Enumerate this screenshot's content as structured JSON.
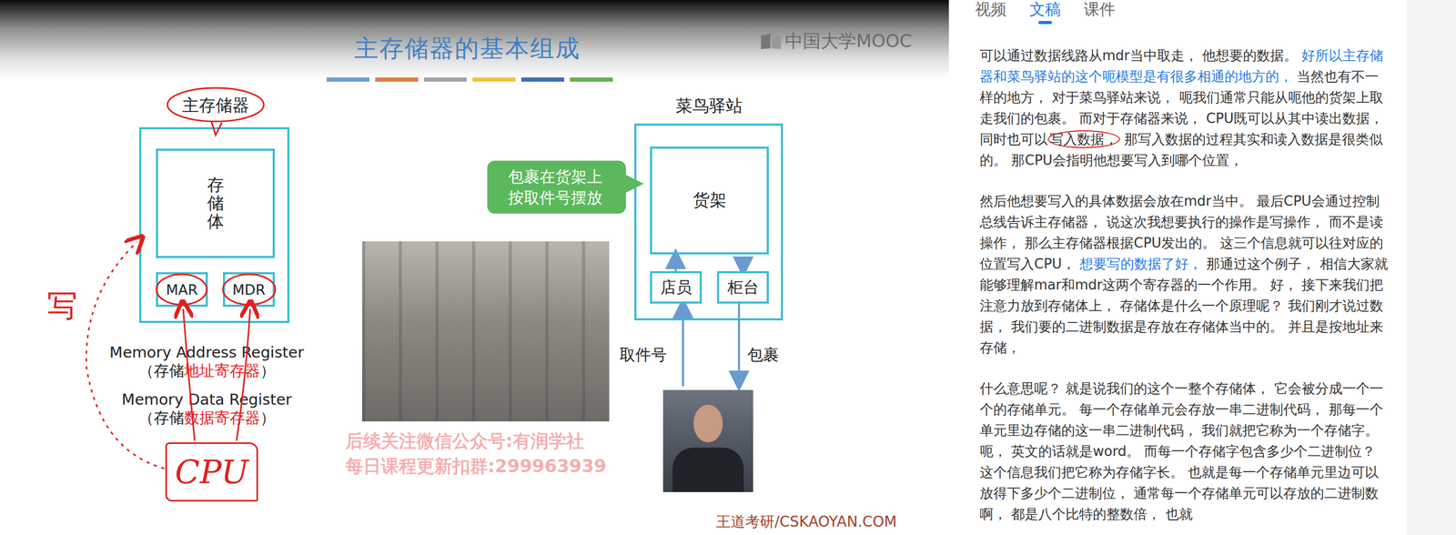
{
  "video": {
    "slide": {
      "title": "主存储器的基本组成",
      "logo": "中国大学MOOC",
      "memory": {
        "title": "主存储器",
        "storage": "存储体",
        "registers": [
          {
            "label": "MAR"
          },
          {
            "label": "MDR"
          }
        ],
        "legend": [
          {
            "english": "Memory Address Register",
            "chinese": [
              {
                "text": "（存储",
                "red": false
              },
              {
                "text": "地址寄存器",
                "red": true
              },
              {
                "text": "）",
                "red": false
              }
            ]
          },
          {
            "english": "Memory Data Register",
            "chinese": [
              {
                "text": "（存储",
                "red": false
              },
              {
                "text": "数据寄存器",
                "red": true
              },
              {
                "text": "）",
                "red": false
              }
            ]
          }
        ]
      },
      "station": {
        "title": "菜鸟驿站",
        "shelf": "货架",
        "counters": [
          {
            "label": "店员"
          },
          {
            "label": "柜台"
          }
        ],
        "callout": "包裹在货架上按取件号摆放",
        "input": "取件号",
        "output": "包裹"
      },
      "watermark": [
        "后续关注微信公众号:有润学社",
        "每日课程更新扣群:299963939"
      ],
      "footer": "王道考研/CSKAOYAN.COM"
    },
    "annotations": {
      "write_mark": "写",
      "cpu": "CPU"
    }
  },
  "panel": {
    "tabs": [
      {
        "label": "视频",
        "selected": false
      },
      {
        "label": "文稿",
        "selected": true
      },
      {
        "label": "课件",
        "selected": false
      }
    ],
    "transcript": [
      {
        "segments": [
          {
            "text": "可以通过数据线路从mdr当中取走， 他想要的数据。 ",
            "highlighted": false,
            "circled": false
          },
          {
            "text": "好所以主存储器和菜鸟驿站的这个呃模型是有很多相通的地方的，",
            "highlighted": true,
            "circled": false
          },
          {
            "text": " 当然也有不一样的地方， 对于菜鸟驿站来说， 呃我们通常只能从呃他的货架上取走我们的包裹。 而对于存储器来说， CPU既可以从其中读出数据， 同时也可以",
            "highlighted": false,
            "circled": false
          },
          {
            "text": "写入数据，",
            "highlighted": false,
            "circled": true
          },
          {
            "text": " 那写入数据的过程其实和读入数据是很类似的。 那CPU会指明他想要写入到哪个位置，",
            "highlighted": false,
            "circled": false
          }
        ]
      },
      {
        "segments": [
          {
            "text": "然后他想要写入的具体数据会放在mdr当中。 最后CPU会通过控制总线告诉主存储器， 说这次我想要执行的操作是写操作， 而不是读操作， 那么主存储器根据CPU发出的。 这三个信息就可以往对应的位置写入CPU， ",
            "highlighted": false,
            "circled": false
          },
          {
            "text": "想要写的数据了好，",
            "highlighted": true,
            "circled": false
          },
          {
            "text": " 那通过这个例子， 相信大家就能够理解mar和mdr这两个寄存器的一个作用。 好， 接下来我们把注意力放到存储体上， 存储体是什么一个原理呢？ 我们刚才说过数据， 我们要的二进制数据是存放在存储体当中的。 并且是按地址来存储，",
            "highlighted": false,
            "circled": false
          }
        ]
      },
      {
        "segments": [
          {
            "text": "什么意思呢？ 就是说我们的这个一整个存储体， 它会被分成一个一个的存储单元。 每一个存储单元会存放一串二进制代码， 那每一个单元里边存储的这一串二进制代码， 我们就把它称为一个存储字。 呃， 英文的话就是word。 而每一个存储字包含多少个二进制位？ 这个信息我们把它称为存储字长。 也就是每一个存储单元里边可以放得下多少个二进制位， 通常每一个存储单元可以存放的二进制数啊， 都是八个比特的整数倍， 也就",
            "highlighted": false,
            "circled": false
          }
        ]
      }
    ]
  }
}
